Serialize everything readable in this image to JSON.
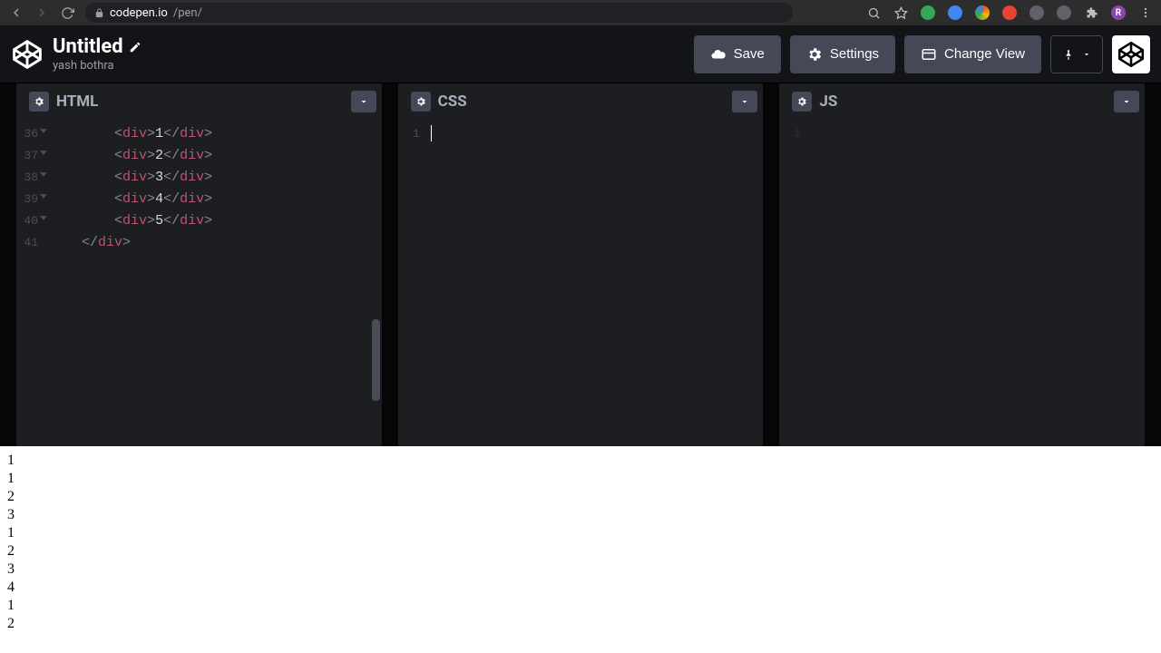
{
  "browser": {
    "url_domain": "codepen.io",
    "url_path": "/pen/",
    "profile_initial": "R"
  },
  "header": {
    "title": "Untitled",
    "author": "yash bothra",
    "save_label": "Save",
    "settings_label": "Settings",
    "change_view_label": "Change View"
  },
  "editors": {
    "html": {
      "label": "HTML",
      "lines": [
        {
          "num": "36",
          "indent": "        ",
          "open": "<div>",
          "text": "1",
          "close": "</div>"
        },
        {
          "num": "37",
          "indent": "        ",
          "open": "<div>",
          "text": "2",
          "close": "</div>"
        },
        {
          "num": "38",
          "indent": "        ",
          "open": "<div>",
          "text": "3",
          "close": "</div>"
        },
        {
          "num": "39",
          "indent": "        ",
          "open": "<div>",
          "text": "4",
          "close": "</div>"
        },
        {
          "num": "40",
          "indent": "        ",
          "open": "<div>",
          "text": "5",
          "close": "</div>"
        },
        {
          "num": "41",
          "indent": "    ",
          "open": "",
          "text": "",
          "close": "</div>"
        }
      ]
    },
    "css": {
      "label": "CSS",
      "first_line": "1"
    },
    "js": {
      "label": "JS",
      "first_line": "1"
    }
  },
  "preview": {
    "lines": [
      "1",
      "1",
      "2",
      "3",
      "1",
      "2",
      "3",
      "4",
      "1",
      "2"
    ]
  }
}
